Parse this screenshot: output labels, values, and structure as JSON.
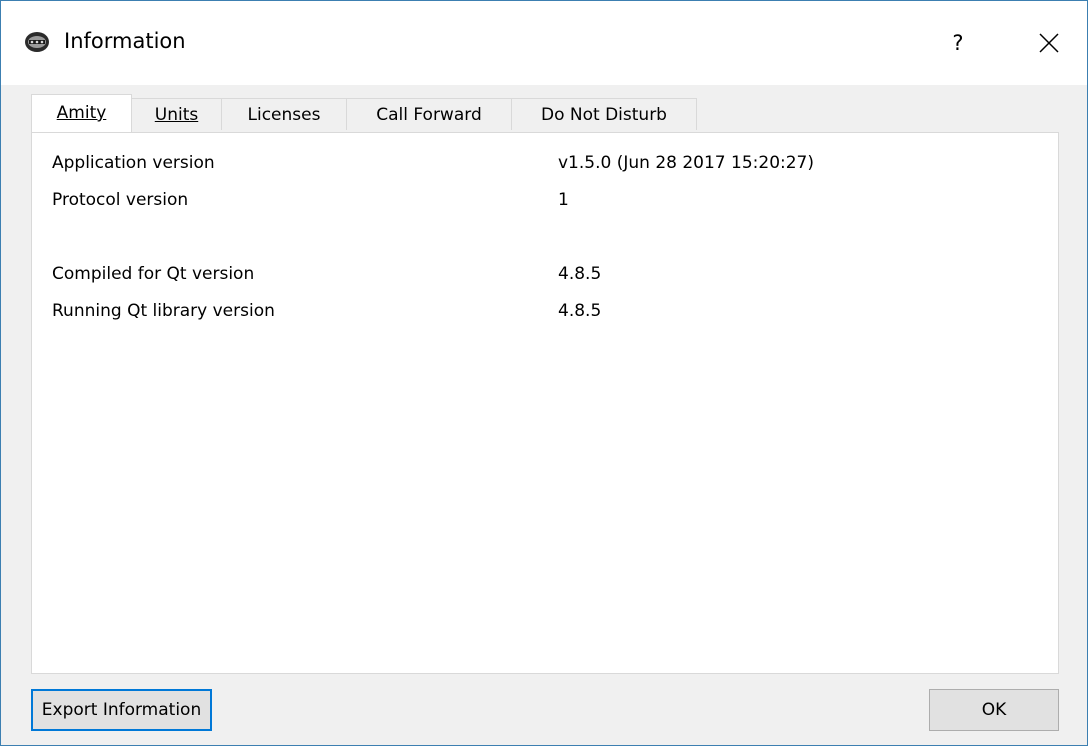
{
  "window": {
    "title": "Information",
    "icon": "amity-app-icon",
    "help_label": "?",
    "close_icon": "close-icon"
  },
  "tabs": [
    {
      "label": "Amity",
      "active": true
    },
    {
      "label": "Units",
      "active": false
    },
    {
      "label": "Licenses",
      "active": false
    },
    {
      "label": "Call Forward",
      "active": false
    },
    {
      "label": "Do Not Disturb",
      "active": false
    }
  ],
  "info": [
    {
      "label": "Application version",
      "value": "v1.5.0 (Jun 28 2017 15:20:27)"
    },
    {
      "label": "Protocol version",
      "value": "1"
    },
    {
      "label": "Compiled for Qt version",
      "value": "4.8.5"
    },
    {
      "label": "Running Qt library version",
      "value": "4.8.5"
    }
  ],
  "buttons": {
    "export_label": "Export Information",
    "ok_label": "OK"
  },
  "colors": {
    "window_border": "#3c7fb1",
    "focus_border": "#0078d7",
    "button_face": "#e1e1e1",
    "dialog_bg": "#f0f0f0"
  }
}
